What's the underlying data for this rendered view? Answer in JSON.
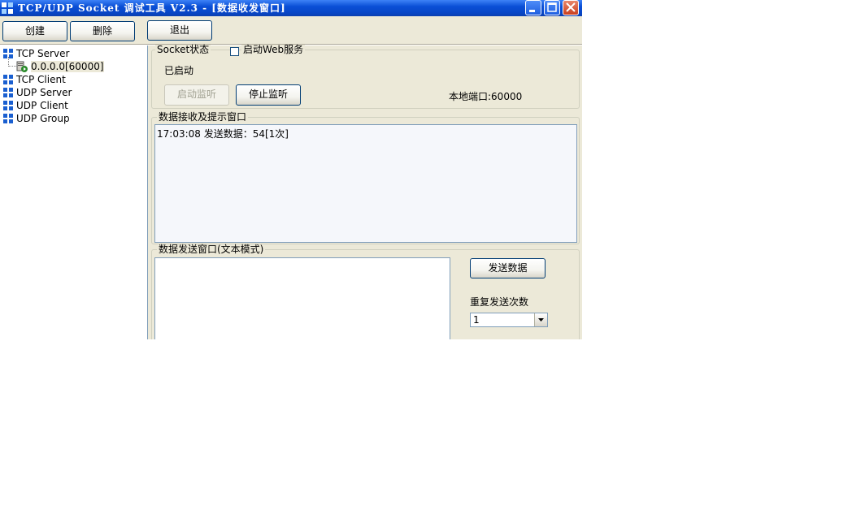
{
  "window": {
    "title": "TCP/UDP Socket 调试工具 V2.3 - [数据收发窗口]"
  },
  "toolbar": {
    "create": "创建",
    "delete": "删除",
    "exit": "退出"
  },
  "tree": {
    "items": [
      {
        "label": "TCP Server"
      },
      {
        "label": "TCP Client"
      },
      {
        "label": "UDP Server"
      },
      {
        "label": "UDP Client"
      },
      {
        "label": "UDP Group"
      }
    ],
    "child": {
      "label": "0.0.0.0[60000]"
    }
  },
  "socket": {
    "legend": "Socket状态",
    "web_service_label": "启动Web服务",
    "status": "已启动",
    "start_listen": "启动监听",
    "stop_listen": "停止监听",
    "local_port": "本地端口:60000"
  },
  "receive": {
    "legend": "数据接收及提示窗口",
    "log": "17:03:08 发送数据：54[1次]"
  },
  "send": {
    "legend": "数据发送窗口(文本模式)",
    "send_button": "发送数据",
    "repeat_label": "重复发送次数",
    "repeat_value": "1"
  }
}
